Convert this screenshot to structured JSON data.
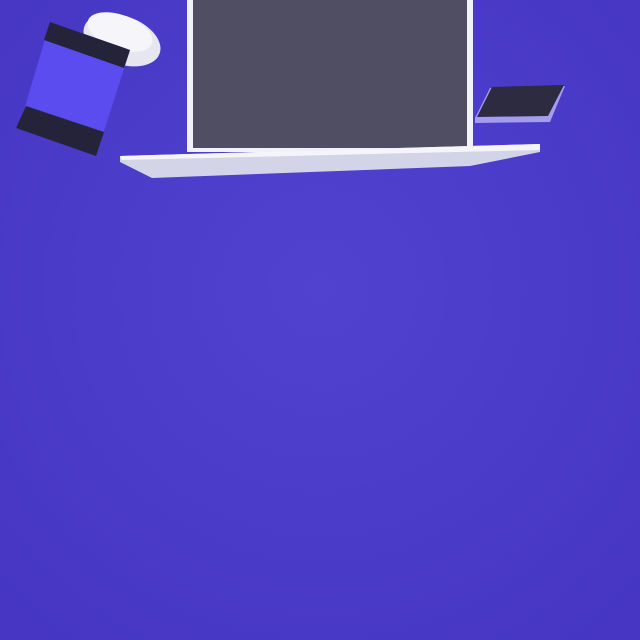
{
  "colors": {
    "background": "#4b3bc9",
    "laptop_screen": "#4f4e63",
    "laptop_body": "#d9d9ec",
    "cup": "#5b4cf0",
    "cup_band": "#25233a",
    "lid": "#e8e8ef",
    "phone_screen": "#2c2b40",
    "phone_body": "#a59cf2"
  },
  "objects": [
    "laptop",
    "coffee-cup",
    "phone"
  ]
}
